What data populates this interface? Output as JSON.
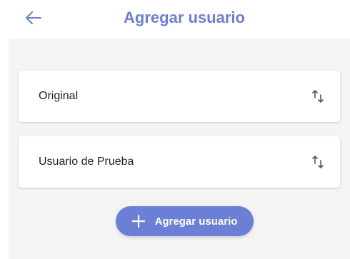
{
  "header": {
    "title": "Agregar usuario",
    "back_icon": "arrow-left-icon"
  },
  "users": [
    {
      "label": "Original",
      "icon": "swap-vertical-icon"
    },
    {
      "label": "Usuario de Prueba",
      "icon": "swap-vertical-icon"
    }
  ],
  "add_button": {
    "label": "Agregar usuario",
    "icon": "plus-icon"
  },
  "colors": {
    "accent": "#6b7fd7",
    "background": "#f4f4f4",
    "card": "#ffffff",
    "text": "#222222",
    "icon": "#555555"
  }
}
